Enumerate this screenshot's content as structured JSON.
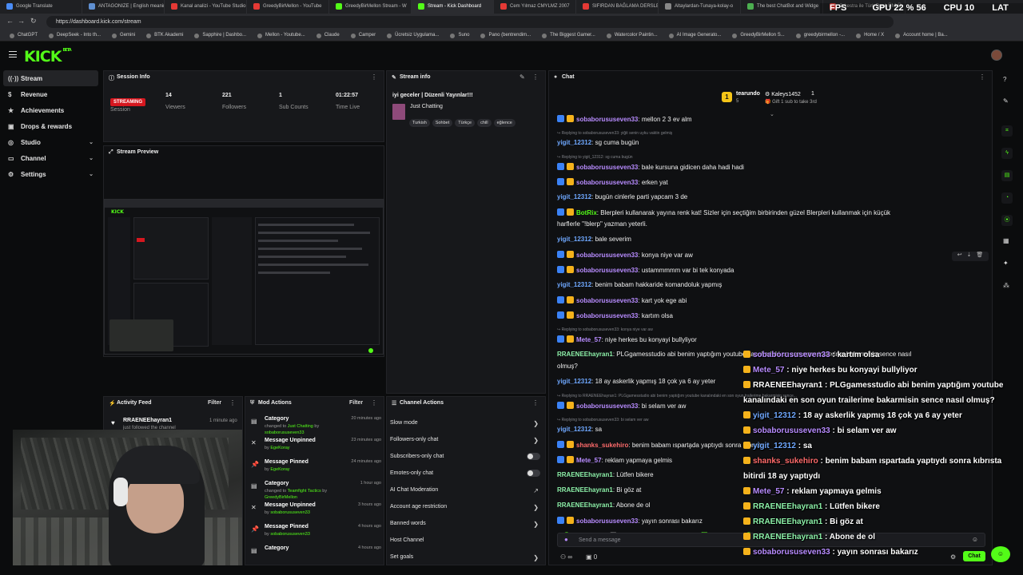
{
  "browser": {
    "tabs": [
      {
        "title": "Google Translate",
        "fav": "#4a8cf7",
        "active": false
      },
      {
        "title": "ANTAGONIZE | English meanin",
        "fav": "#5f8fd0",
        "active": false
      },
      {
        "title": "Kanal analizi - YouTube Studio",
        "fav": "#e53935",
        "active": false
      },
      {
        "title": "GreedyBirMellon - YouTube",
        "fav": "#e53935",
        "active": false
      },
      {
        "title": "GreedyBirMellon Stream - W",
        "fav": "#53fc18",
        "active": false
      },
      {
        "title": "Stream - Kick Dashboard",
        "fav": "#53fc18",
        "active": true
      },
      {
        "title": "Cem Yılmaz CMYLMZ 2007",
        "fav": "#e53935",
        "active": false
      },
      {
        "title": "SIFIRDAN BAĞLAMA DERSLE",
        "fav": "#e53935",
        "active": false
      },
      {
        "title": "Altaylardan-Tunaya-kolay-o",
        "fav": "#888888",
        "active": false
      },
      {
        "title": "The best ChatBot and Widge",
        "fav": "#4caf50",
        "active": false
      },
      {
        "title": "Orkestra ile Türk Rock ÜNLÜ",
        "fav": "#e53935",
        "active": false
      }
    ],
    "url": "https://dashboard.kick.com/stream",
    "nav_glyphs": [
      "←",
      "→",
      "↻"
    ],
    "overlay_stats": [
      "FPS N/A",
      "GPU 22 % 56 °C",
      "CPU 10 %",
      "LAT N/A"
    ],
    "bookmarks": [
      "ChatGPT",
      "DeepSeek - Into th...",
      "Gemini",
      "BTK Akademi",
      "Sapphire | Dashbo...",
      "Mellon - Youtube...",
      "Claude",
      "Camper",
      "Ücretsiz Uygulama...",
      "Suno",
      "Pano (bentrendim...",
      "The Biggest Gamer...",
      "Watercolor Paintin...",
      "AI Image Generato...",
      "GreedyBirMellon S...",
      "greedybirmellon -...",
      "Home / X",
      "Account home | Ba..."
    ]
  },
  "header": {
    "logo": "KICK",
    "logo_sup": "BETA",
    "menu_icon": "hamburger-icon"
  },
  "nav": {
    "items": [
      {
        "label": "Stream",
        "icon": "((·))",
        "active": true,
        "chevron": false
      },
      {
        "label": "Revenue",
        "icon": "$",
        "active": false,
        "chevron": false
      },
      {
        "label": "Achievements",
        "icon": "★",
        "active": false,
        "chevron": false
      },
      {
        "label": "Drops & rewards",
        "icon": "▣",
        "active": false,
        "chevron": false
      },
      {
        "label": "Studio",
        "icon": "◎",
        "active": false,
        "chevron": true
      },
      {
        "label": "Channel",
        "icon": "▭",
        "active": false,
        "chevron": true
      },
      {
        "label": "Settings",
        "icon": "⚙",
        "active": false,
        "chevron": true
      }
    ]
  },
  "session_info": {
    "title": "Session Info",
    "badge": "STREAMING",
    "badge_label": "Session",
    "stats": [
      {
        "value": "14",
        "label": "Viewers"
      },
      {
        "value": "221",
        "label": "Followers"
      },
      {
        "value": "1",
        "label": "Sub Counts"
      },
      {
        "value": "01:22:57",
        "label": "Time Live"
      }
    ]
  },
  "stream_info": {
    "title": "Stream info",
    "stream_title": "iyi geceler | Düzenli Yayınlar!!!",
    "category": "Just Chatting",
    "tags": [
      "Turkish",
      "Sohbet",
      "Türkçe",
      "chill",
      "eğlence"
    ]
  },
  "stream_preview": {
    "title": "Stream Preview"
  },
  "chat": {
    "title": "Chat",
    "pinned": {
      "user": "tearundo",
      "badge_count": "5",
      "gifter": "Kaleys1452",
      "gift_count": "1",
      "gift_text": "Gift 1 sub to take 3rd"
    },
    "messages": [
      {
        "type": "msg",
        "user": "sobaborususeven33",
        "color": "#b88cff",
        "text": ": mellon 2 3 ev alm",
        "badges": true
      },
      {
        "type": "reply",
        "text": "↪ Replying to sobaborususeven33: yiğit senin uyku vaktin gelmiş"
      },
      {
        "type": "msg",
        "user": "yigit_12312",
        "color": "#6fa8ff",
        "text": ": sg cuma bugün",
        "badges": false
      },
      {
        "type": "reply",
        "text": "↪ Replying to yigit_12312: sg cuma bugün"
      },
      {
        "type": "msg",
        "user": "sobaborususeven33",
        "color": "#b88cff",
        "text": ": bale kursuna gidicen daha hadi hadi",
        "badges": true
      },
      {
        "type": "msg",
        "user": "sobaborususeven33",
        "color": "#b88cff",
        "text": ": erken yat",
        "badges": true
      },
      {
        "type": "msg",
        "user": "yigit_12312",
        "color": "#6fa8ff",
        "text": ": bugün cinlerle parti yapcam 3 de",
        "badges": false
      },
      {
        "type": "msg",
        "user": "BotRix",
        "color": "#53fc18",
        "text": ": Blerpleri kullanarak yayına renk kat! Sizler için seçtiğim birbirinden güzel Blerpleri kullanmak için küçük",
        "badges": true
      },
      {
        "type": "cont",
        "text": "harflerle \"!blerp\" yazman yeterli."
      },
      {
        "type": "msg",
        "user": "yigit_12312",
        "color": "#6fa8ff",
        "text": ": bale severim",
        "badges": false
      },
      {
        "type": "msg",
        "user": "sobaborususeven33",
        "color": "#b88cff",
        "text": ": konya niye var aw",
        "badges": true
      },
      {
        "type": "msg",
        "user": "sobaborususeven33",
        "color": "#b88cff",
        "text": ": ustammmmm var bi tek konyada",
        "badges": true
      },
      {
        "type": "msg",
        "user": "yigit_12312",
        "color": "#6fa8ff",
        "text": ": benim babam hakkaride komandoluk yapmış",
        "badges": false
      },
      {
        "type": "msg",
        "user": "sobaborususeven33",
        "color": "#b88cff",
        "text": ": kart yok ege abi",
        "badges": true
      },
      {
        "type": "msg",
        "user": "sobaborususeven33",
        "color": "#b88cff",
        "text": ": kartım olsa",
        "badges": true
      },
      {
        "type": "reply",
        "text": "↪ Replying to sobaborususeven33: konya niye var aw"
      },
      {
        "type": "msg",
        "user": "Mete_57",
        "color": "#b88cff",
        "text": ": niye herkes bu konyayi bullyliyor",
        "badges": true
      },
      {
        "type": "msg",
        "user": "RRAENEEhayran1",
        "color": "#8cf0a8",
        "text": ": PLGgamesstudio abi benim yaptığım youtube kanalındaki en son oyun trailerime bakarmisin sence nasıl",
        "badges": false
      },
      {
        "type": "cont",
        "text": "olmuş?"
      },
      {
        "type": "msg",
        "user": "yigit_12312",
        "color": "#6fa8ff",
        "text": ": 18 ay askerlik yapmış 18 çok ya 6 ay yeter",
        "badges": false
      },
      {
        "type": "reply",
        "text": "↪ Replying to RRAENEEhayran1: PLGgamesstudio abi benim yaptığım youtube kanalındaki en son oyun trailerime bakarmisin sence..."
      },
      {
        "type": "msg",
        "user": "sobaborususeven33",
        "color": "#b88cff",
        "text": ": bi selam ver aw",
        "badges": true
      },
      {
        "type": "reply",
        "text": "↪ Replying to sobaborususeven33: bi selam ver aw"
      },
      {
        "type": "msg",
        "user": "yigit_12312",
        "color": "#6fa8ff",
        "text": ": sa",
        "badges": false
      },
      {
        "type": "msg",
        "user": "shanks_sukehiro",
        "color": "#ff6b6b",
        "text": ": benim babam ısparta̧da yaptıydı sonra kıbrısta",
        "badges": true
      },
      {
        "type": "msg",
        "user": "Mete_57",
        "color": "#b88cff",
        "text": ": reklam yapmaya gelmis",
        "badges": true
      },
      {
        "type": "msg",
        "user": "RRAENEEhayran1",
        "color": "#8cf0a8",
        "text": ": Lütfen bikere",
        "badges": false
      },
      {
        "type": "msg",
        "user": "RRAENEEhayran1",
        "color": "#8cf0a8",
        "text": ": Bi göz at",
        "badges": false
      },
      {
        "type": "msg",
        "user": "RRAENEEhayran1",
        "color": "#8cf0a8",
        "text": ": Abone de ol",
        "badges": false
      },
      {
        "type": "msg",
        "user": "sobaborususeven33",
        "color": "#b88cff",
        "text": ": yayın sonrası bakarız",
        "badges": true
      }
    ],
    "input_placeholder": "Send a message",
    "chat_button": "Chat",
    "bottom_left_count": "∞",
    "bottom_left_num": "0"
  },
  "overlay_chat": [
    {
      "user": "sobaborususeven33",
      "color": "#b88cff",
      "text": " : kartım olsa"
    },
    {
      "user": "Mete_57",
      "color": "#b88cff",
      "text": " : niye herkes bu konyayi bullyliyor"
    },
    {
      "user": "RRAENEEhayran1",
      "color": "#ffffff",
      "text": " : PLGgamesstudio abi benim yaptığım youtube"
    },
    {
      "user": "",
      "color": "#ffffff",
      "text": "kanalındaki en son oyun trailerime bakarmisin sence nasıl olmuş?"
    },
    {
      "user": "yigit_12312",
      "color": "#6fa8ff",
      "text": " : 18 ay askerlik yapmış 18 çok ya 6 ay yeter"
    },
    {
      "user": "sobaborususeven33",
      "color": "#b88cff",
      "text": " : bi selam ver aw"
    },
    {
      "user": "yigit_12312",
      "color": "#6fa8ff",
      "text": " : sa"
    },
    {
      "user": "shanks_sukehiro",
      "color": "#ff6b6b",
      "text": " : benim babam ıspartada yaptıydı sonra kıbrısta"
    },
    {
      "user": "",
      "color": "#ffffff",
      "text": "bitirdi 18 ay yaptıydı"
    },
    {
      "user": "Mete_57",
      "color": "#b88cff",
      "text": " : reklam yapmaya gelmis"
    },
    {
      "user": "RRAENEEhayran1",
      "color": "#8cf0a8",
      "text": " : Lütfen bikere"
    },
    {
      "user": "RRAENEEhayran1",
      "color": "#8cf0a8",
      "text": " : Bi göz at"
    },
    {
      "user": "RRAENEEhayran1",
      "color": "#8cf0a8",
      "text": " : Abone de ol"
    },
    {
      "user": "sobaborususeven33",
      "color": "#b88cff",
      "text": " : yayın sonrası bakarız"
    }
  ],
  "activity_feed": {
    "title": "Activity Feed",
    "filter": "Filter",
    "items": [
      {
        "user": "RRAENEEhayran1",
        "action": "just followed the channel",
        "time": "1 minute ago"
      }
    ]
  },
  "mod_actions": {
    "title": "Mod Actions",
    "filter": "Filter",
    "items": [
      {
        "title": "Category",
        "line": "changed to",
        "highlight": "Just Chatting",
        "by": "by",
        "user": "sobaborususeven33",
        "time": "20 minutes ago",
        "icon": "▤"
      },
      {
        "title": "Message Unpinned",
        "line": "",
        "highlight": "",
        "by": "by",
        "user": "EgeKoray",
        "time": "23 minutes ago",
        "icon": "✕"
      },
      {
        "title": "Message Pinned",
        "line": "",
        "highlight": "",
        "by": "by",
        "user": "EgeKoray",
        "time": "24 minutes ago",
        "icon": "📌"
      },
      {
        "title": "Category",
        "line": "changed to",
        "highlight": "Teamfight Tactics",
        "by": "by",
        "user": "GreedyBirMellon",
        "time": "1 hour ago",
        "icon": "▤"
      },
      {
        "title": "Message Unpinned",
        "line": "",
        "highlight": "",
        "by": "by",
        "user": "sobaborususeven33",
        "time": "3 hours ago",
        "icon": "✕"
      },
      {
        "title": "Message Pinned",
        "line": "",
        "highlight": "",
        "by": "by",
        "user": "sobaborususeven33",
        "time": "4 hours ago",
        "icon": "📌"
      },
      {
        "title": "Category",
        "line": "",
        "highlight": "",
        "by": "",
        "user": "",
        "time": "4 hours ago",
        "icon": "▤"
      }
    ]
  },
  "channel_actions": {
    "title": "Channel Actions",
    "items": [
      {
        "label": "Slow mode",
        "control": "arrow"
      },
      {
        "label": "Followers-only chat",
        "control": "arrow"
      },
      {
        "label": "Subscribers-only chat",
        "control": "toggle"
      },
      {
        "label": "Emotes-only chat",
        "control": "toggle"
      },
      {
        "label": "AI Chat Moderation",
        "control": "link"
      },
      {
        "label": "Account age restriction",
        "control": "arrow"
      },
      {
        "label": "Banned words",
        "control": "arrow"
      },
      {
        "label": "Host Channel",
        "control": "none"
      },
      {
        "label": "Set goals",
        "control": "arrow"
      }
    ]
  },
  "colors": {
    "accent": "#53fc18",
    "live": "#d6171f",
    "panel": "#17181b"
  }
}
